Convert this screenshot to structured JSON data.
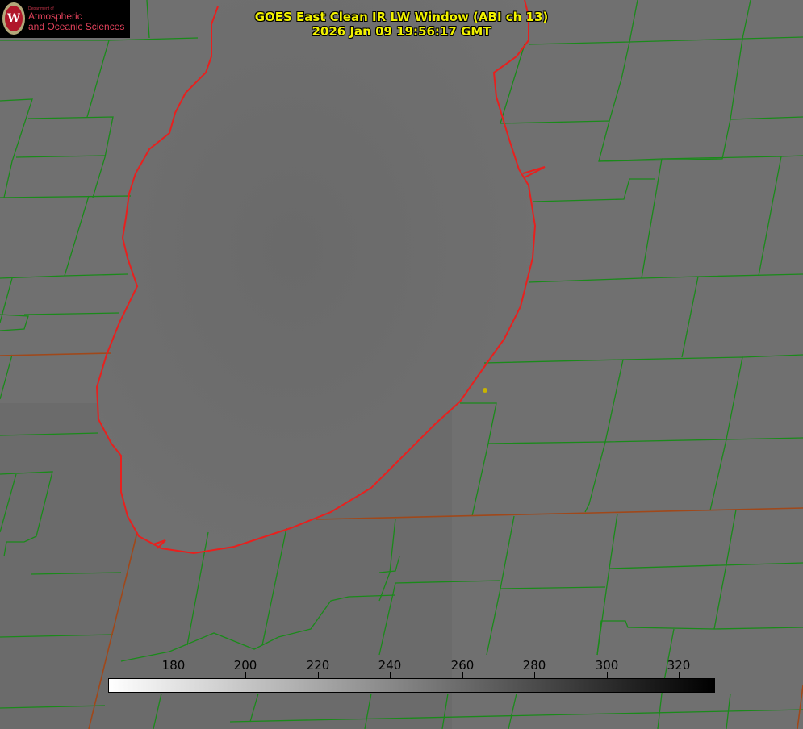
{
  "title_line1": "GOES East Clean IR LW Window (ABI ch 13)",
  "title_line2": "2026 Jan 09 19:56:17 GMT",
  "logo": {
    "dept": "Department of",
    "line1": "Atmospheric",
    "line2": "and Oceanic Sciences",
    "seal_letter": "W"
  },
  "colorbar": {
    "ticks": [
      "180",
      "200",
      "220",
      "240",
      "260",
      "280",
      "300",
      "320"
    ]
  },
  "colors": {
    "county_lines": "#1a8a1a",
    "coastline": "#e8201e",
    "state_lines": "#9a4a1a",
    "title": "#f2f200",
    "marker": "#c8b400"
  },
  "icons": [
    "uw-seal-icon",
    "location-marker-icon"
  ]
}
